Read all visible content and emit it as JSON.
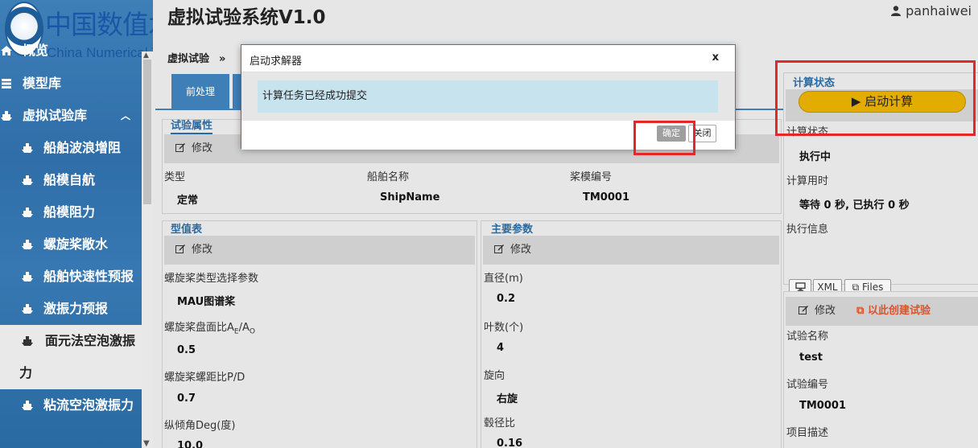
{
  "brand": {
    "name_cn": "中国数值水池",
    "name_en": "China Numerical Tank"
  },
  "header": {
    "title": "虚拟试验系统V1.0",
    "username": "panhaiwei"
  },
  "sidebar": {
    "items": [
      {
        "label": "概览",
        "icon": "home-icon"
      },
      {
        "label": "模型库",
        "icon": "database-icon"
      },
      {
        "label": "虚拟试验库",
        "icon": "ship-icon",
        "expanded": true
      },
      {
        "label": "船舶波浪增阻",
        "icon": "ship-icon"
      },
      {
        "label": "船模自航",
        "icon": "ship-icon"
      },
      {
        "label": "船模阻力",
        "icon": "ship-icon"
      },
      {
        "label": "螺旋桨敞水",
        "icon": "ship-icon"
      },
      {
        "label": "船舶快速性预报",
        "icon": "ship-icon"
      },
      {
        "label": "激振力预报",
        "icon": "ship-icon"
      },
      {
        "label": "面元法空泡激振力",
        "icon": "ship-icon",
        "active": true
      },
      {
        "label": "粘流空泡激振力",
        "icon": "ship-icon"
      }
    ]
  },
  "breadcrumb": {
    "current": "虚拟试验",
    "separator": "»"
  },
  "tabs": [
    {
      "label": "前处理"
    }
  ],
  "edit_label": "修改",
  "test_attrs": {
    "title": "试验属性",
    "fields": [
      {
        "label": "类型",
        "value": "定常"
      },
      {
        "label": "船舶名称",
        "value": "ShipName"
      },
      {
        "label": "桨模编号",
        "value": "TM0001"
      }
    ]
  },
  "profile_table": {
    "title": "型值表",
    "fields": [
      {
        "label": "螺旋桨类型选择参数",
        "value": "MAU图谱桨"
      },
      {
        "label": "螺旋桨盘面比A",
        "label_sub": "E",
        "label_mid": "/A",
        "label_sub2": "O",
        "value": "0.5"
      },
      {
        "label": "螺旋桨螺距比P/D",
        "value": "0.7"
      },
      {
        "label": "纵倾角Deg(度)",
        "value": "10.0"
      }
    ]
  },
  "main_params": {
    "title": "主要参数",
    "fields": [
      {
        "label": "直径(m)",
        "value": "0.2"
      },
      {
        "label": "叶数(个)",
        "value": "4"
      },
      {
        "label": "旋向",
        "value": "右旋"
      },
      {
        "label": "毂径比",
        "value": "0.16"
      }
    ]
  },
  "calc_status": {
    "title": "计算状态",
    "start_button": "启动计算",
    "status_label": "计算状态",
    "status_value": "执行中",
    "time_label": "计算用时",
    "time_value": "等待 0 秒, 已执行 0 秒",
    "info_label": "执行信息",
    "buttons": {
      "xml": "XML",
      "files": "Files"
    }
  },
  "test_info": {
    "edit": "修改",
    "create": "以此创建试验",
    "name_label": "试验名称",
    "name_value": "test",
    "id_label": "试验编号",
    "id_value": "TM0001",
    "desc_label": "项目描述"
  },
  "modal": {
    "title": "启动求解器",
    "close_x": "x",
    "message": "计算任务已经成功提交",
    "ok": "确定",
    "close": "关闭"
  },
  "colors": {
    "accent": "#3f7fb8",
    "start": "#e2ac00",
    "highlight": "#e5262a",
    "create": "#d9532b",
    "alert": "#c7e3ee"
  }
}
